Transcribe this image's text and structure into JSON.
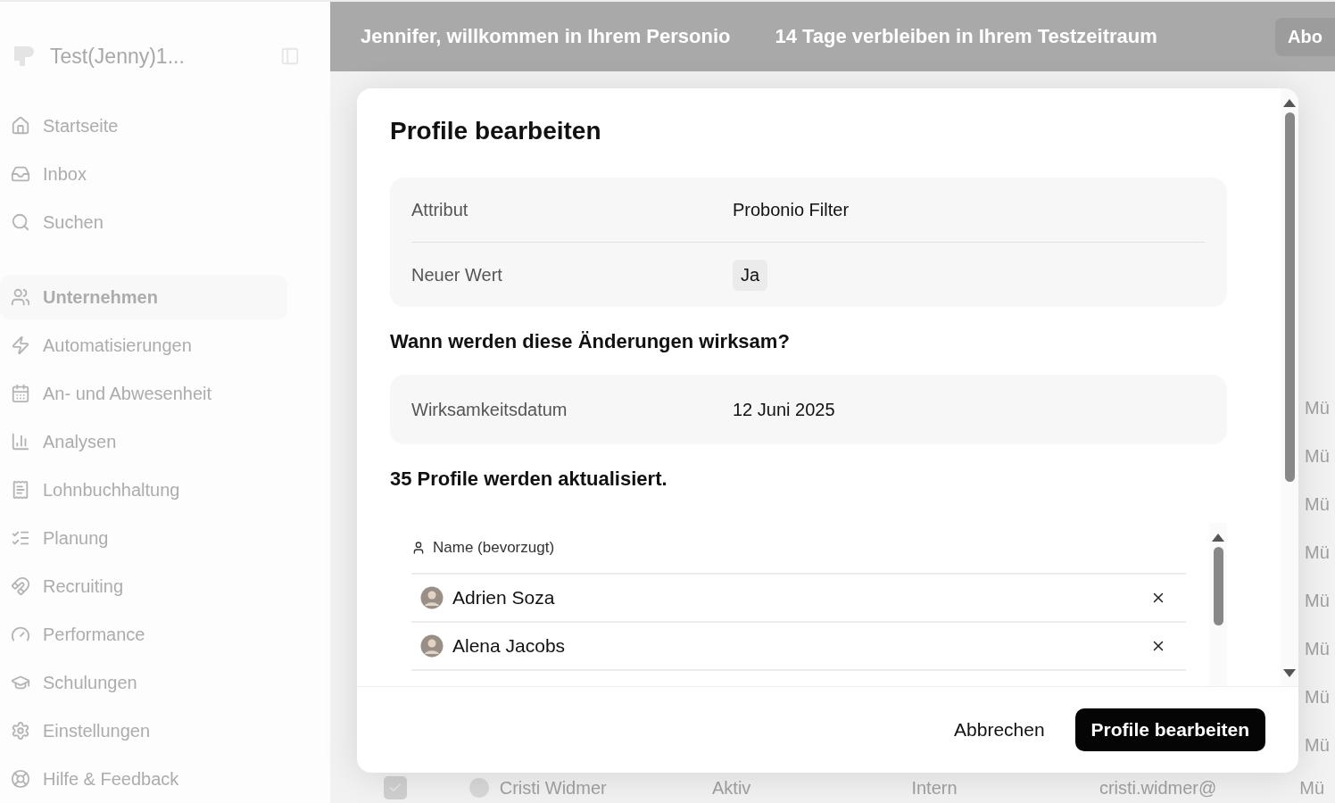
{
  "sidebar": {
    "workspace": "Test(Jenny)1...",
    "items": [
      {
        "label": "Startseite",
        "selected": false
      },
      {
        "label": "Inbox",
        "selected": false
      },
      {
        "label": "Suchen",
        "selected": false
      },
      {
        "label": "Unternehmen",
        "selected": true
      },
      {
        "label": "Automatisierungen",
        "selected": false
      },
      {
        "label": "An- und Abwesenheit",
        "selected": false
      },
      {
        "label": "Analysen",
        "selected": false
      },
      {
        "label": "Lohnbuchhaltung",
        "selected": false
      },
      {
        "label": "Planung",
        "selected": false
      },
      {
        "label": "Recruiting",
        "selected": false
      },
      {
        "label": "Performance",
        "selected": false
      },
      {
        "label": "Schulungen",
        "selected": false
      }
    ],
    "footer_items": [
      {
        "label": "Einstellungen"
      },
      {
        "label": "Hilfe & Feedback"
      }
    ]
  },
  "banner": {
    "welcome": "Jennifer, willkommen in Ihrem Personio",
    "trial": "14 Tage verbleiben in Ihrem Testzeitraum",
    "button": "Abo"
  },
  "background_table": {
    "column_5_cells": [
      "Mü",
      "Mü",
      "Mü",
      "Mü",
      "Mü",
      "Mü",
      "Mü",
      "Mü"
    ],
    "rows": [
      {
        "checked": true,
        "name": "Cristi Widmer",
        "status": "Aktiv",
        "type": "Intern",
        "email": "cristi.widmer@",
        "column_5": "Mü"
      }
    ]
  },
  "dialog": {
    "title": "Profile bearbeiten",
    "changes": [
      {
        "label": "Attribut",
        "value": "Probonio Filter",
        "kind": "text"
      },
      {
        "label": "Neuer Wert",
        "value": "Ja",
        "kind": "tag"
      }
    ],
    "effective_heading": "Wann werden diese Änderungen wirksam?",
    "effective": {
      "label": "Wirksamkeitsdatum",
      "value": "12 Juni 2025"
    },
    "count_text": "35 Profile werden aktualisiert.",
    "list": {
      "column": "Name (bevorzugt)",
      "rows": [
        {
          "name": "Adrien Soza"
        },
        {
          "name": "Alena Jacobs"
        }
      ]
    },
    "buttons": {
      "cancel": "Abbrechen",
      "confirm": "Profile bearbeiten"
    }
  }
}
